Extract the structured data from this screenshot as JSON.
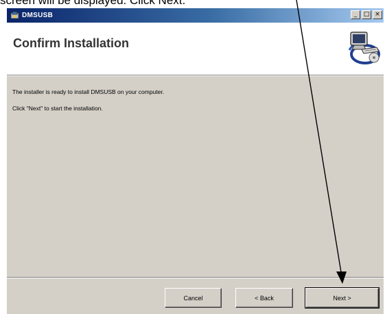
{
  "caption": {
    "text": "screen will be displayed. Click Next."
  },
  "window": {
    "title": "DMSUSB",
    "controls": {
      "minimize": "_",
      "maximize": "□",
      "close": "×"
    }
  },
  "banner": {
    "title": "Confirm Installation",
    "icon": "computer-install-icon"
  },
  "body": {
    "line1": "The installer is ready to install DMSUSB on your computer.",
    "line2": "Click \"Next\" to start the installation."
  },
  "buttons": {
    "cancel": "Cancel",
    "back": "< Back",
    "next": "Next >"
  },
  "annotation": {
    "type": "arrow-pointer",
    "color": "#000000"
  }
}
